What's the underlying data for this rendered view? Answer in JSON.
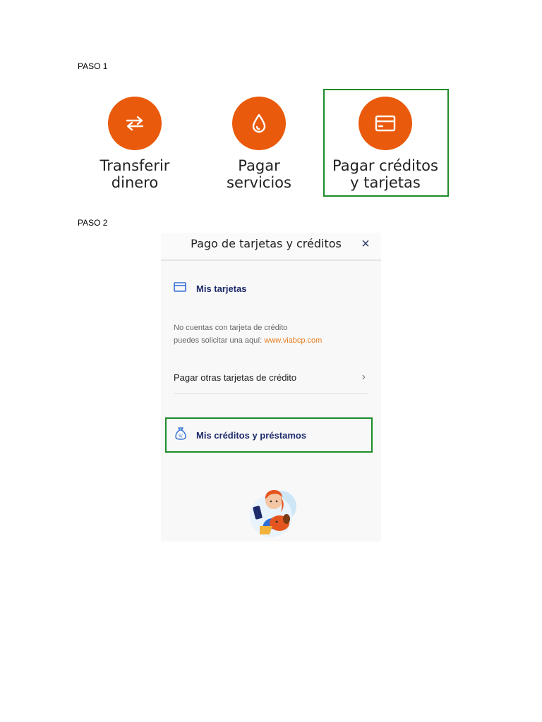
{
  "steps": {
    "step1": "PASO 1",
    "step2": "PASO 2"
  },
  "actions": [
    {
      "line1": "Transferir",
      "line2": "dinero",
      "icon": "transfer-arrows-icon"
    },
    {
      "line1": "Pagar",
      "line2": "servicios",
      "icon": "water-drop-icon"
    },
    {
      "line1": "Pagar créditos",
      "line2": "y tarjetas",
      "icon": "credit-card-icon"
    }
  ],
  "panel": {
    "title": "Pago de tarjetas y créditos",
    "close": "×",
    "my_cards": "Mis tarjetas",
    "no_cards_line1": "No cuentas con tarjeta de crédito",
    "no_cards_line2_prefix": "puedes solicitar una aquí: ",
    "no_cards_link": "www.viabcp.com",
    "other_cards": "Pagar otras tarjetas de crédito",
    "chevron": "›",
    "my_credits": "Mis créditos y préstamos"
  },
  "colors": {
    "accent_orange": "#ea5a0c",
    "highlight_green": "#1e8c2a",
    "navy_text": "#1d2b6b",
    "link_orange": "#e67e22"
  }
}
